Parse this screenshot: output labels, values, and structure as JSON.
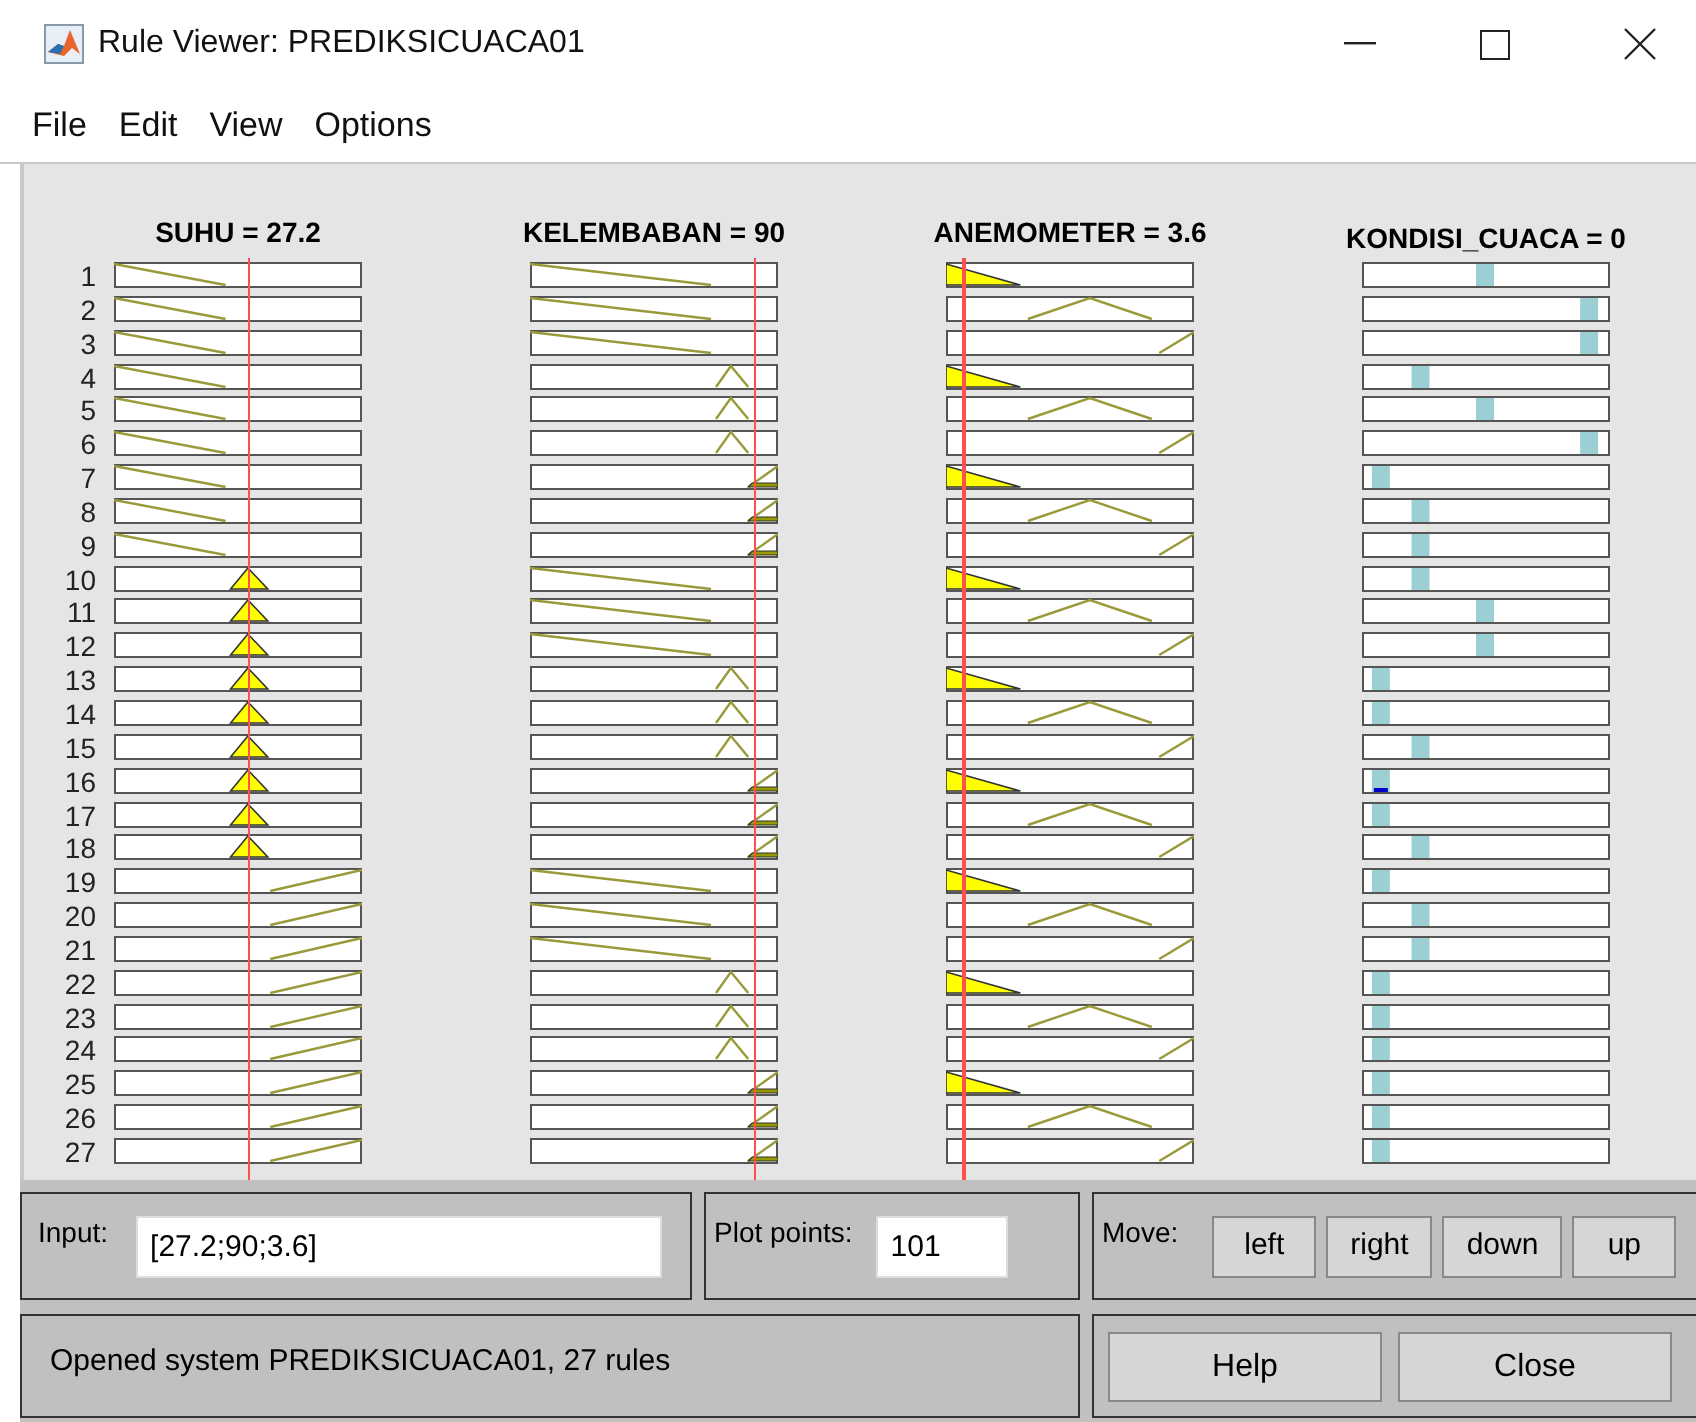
{
  "window": {
    "title": "Rule Viewer: PREDIKSICUACA01"
  },
  "menu": [
    "File",
    "Edit",
    "View",
    "Options"
  ],
  "variables": [
    {
      "label": "SUHU = 27.2"
    },
    {
      "label": "KELEMBABAN = 90"
    },
    {
      "label": "ANEMOMETER = 3.6"
    },
    {
      "label": "KONDISI_CUACA = 0"
    }
  ],
  "rules": [
    {
      "number": "1",
      "inputs": [
        {
          "kind": "falling",
          "fired": false
        },
        {
          "kind": "falling",
          "fired": false
        },
        {
          "kind": "falling",
          "fired": true
        }
      ],
      "output": {
        "kind": "p3",
        "fired": false
      }
    },
    {
      "number": "2",
      "inputs": [
        {
          "kind": "falling",
          "fired": false
        },
        {
          "kind": "falling",
          "fired": false
        },
        {
          "kind": "triangle",
          "fired": false
        }
      ],
      "output": {
        "kind": "p5",
        "fired": false
      }
    },
    {
      "number": "3",
      "inputs": [
        {
          "kind": "falling",
          "fired": false
        },
        {
          "kind": "falling",
          "fired": false
        },
        {
          "kind": "rising",
          "fired": false
        }
      ],
      "output": {
        "kind": "p5",
        "fired": false
      }
    },
    {
      "number": "4",
      "inputs": [
        {
          "kind": "falling",
          "fired": false
        },
        {
          "kind": "triangle",
          "fired": false
        },
        {
          "kind": "falling",
          "fired": true
        }
      ],
      "output": {
        "kind": "p2",
        "fired": false
      }
    },
    {
      "number": "5",
      "inputs": [
        {
          "kind": "falling",
          "fired": false
        },
        {
          "kind": "triangle",
          "fired": false
        },
        {
          "kind": "triangle",
          "fired": false
        }
      ],
      "output": {
        "kind": "p3",
        "fired": false
      }
    },
    {
      "number": "6",
      "inputs": [
        {
          "kind": "falling",
          "fired": false
        },
        {
          "kind": "triangle",
          "fired": false
        },
        {
          "kind": "rising",
          "fired": false
        }
      ],
      "output": {
        "kind": "p5",
        "fired": false
      }
    },
    {
      "number": "7",
      "inputs": [
        {
          "kind": "falling",
          "fired": false
        },
        {
          "kind": "rising",
          "fired": true
        },
        {
          "kind": "falling",
          "fired": true
        }
      ],
      "output": {
        "kind": "p1",
        "fired": false
      }
    },
    {
      "number": "8",
      "inputs": [
        {
          "kind": "falling",
          "fired": false
        },
        {
          "kind": "rising",
          "fired": true
        },
        {
          "kind": "triangle",
          "fired": false
        }
      ],
      "output": {
        "kind": "p2",
        "fired": false
      }
    },
    {
      "number": "9",
      "inputs": [
        {
          "kind": "falling",
          "fired": false
        },
        {
          "kind": "rising",
          "fired": true
        },
        {
          "kind": "rising",
          "fired": false
        }
      ],
      "output": {
        "kind": "p2",
        "fired": false
      }
    },
    {
      "number": "10",
      "inputs": [
        {
          "kind": "triangle",
          "fired": true
        },
        {
          "kind": "falling",
          "fired": false
        },
        {
          "kind": "falling",
          "fired": true
        }
      ],
      "output": {
        "kind": "p2",
        "fired": false
      }
    },
    {
      "number": "11",
      "inputs": [
        {
          "kind": "triangle",
          "fired": true
        },
        {
          "kind": "falling",
          "fired": false
        },
        {
          "kind": "triangle",
          "fired": false
        }
      ],
      "output": {
        "kind": "p3",
        "fired": false
      }
    },
    {
      "number": "12",
      "inputs": [
        {
          "kind": "triangle",
          "fired": true
        },
        {
          "kind": "falling",
          "fired": false
        },
        {
          "kind": "rising",
          "fired": false
        }
      ],
      "output": {
        "kind": "p3",
        "fired": false
      }
    },
    {
      "number": "13",
      "inputs": [
        {
          "kind": "triangle",
          "fired": true
        },
        {
          "kind": "triangle",
          "fired": false
        },
        {
          "kind": "falling",
          "fired": true
        }
      ],
      "output": {
        "kind": "p1",
        "fired": false
      }
    },
    {
      "number": "14",
      "inputs": [
        {
          "kind": "triangle",
          "fired": true
        },
        {
          "kind": "triangle",
          "fired": false
        },
        {
          "kind": "triangle",
          "fired": false
        }
      ],
      "output": {
        "kind": "p1",
        "fired": false
      }
    },
    {
      "number": "15",
      "inputs": [
        {
          "kind": "triangle",
          "fired": true
        },
        {
          "kind": "triangle",
          "fired": false
        },
        {
          "kind": "rising",
          "fired": false
        }
      ],
      "output": {
        "kind": "p2",
        "fired": false
      }
    },
    {
      "number": "16",
      "inputs": [
        {
          "kind": "triangle",
          "fired": true
        },
        {
          "kind": "rising",
          "fired": true
        },
        {
          "kind": "falling",
          "fired": true
        }
      ],
      "output": {
        "kind": "p1",
        "fired": true
      }
    },
    {
      "number": "17",
      "inputs": [
        {
          "kind": "triangle",
          "fired": true
        },
        {
          "kind": "rising",
          "fired": true
        },
        {
          "kind": "triangle",
          "fired": false
        }
      ],
      "output": {
        "kind": "p1",
        "fired": false
      }
    },
    {
      "number": "18",
      "inputs": [
        {
          "kind": "triangle",
          "fired": true
        },
        {
          "kind": "rising",
          "fired": true
        },
        {
          "kind": "rising",
          "fired": false
        }
      ],
      "output": {
        "kind": "p2",
        "fired": false
      }
    },
    {
      "number": "19",
      "inputs": [
        {
          "kind": "rising",
          "fired": false
        },
        {
          "kind": "falling",
          "fired": false
        },
        {
          "kind": "falling",
          "fired": true
        }
      ],
      "output": {
        "kind": "p1",
        "fired": false
      }
    },
    {
      "number": "20",
      "inputs": [
        {
          "kind": "rising",
          "fired": false
        },
        {
          "kind": "falling",
          "fired": false
        },
        {
          "kind": "triangle",
          "fired": false
        }
      ],
      "output": {
        "kind": "p2",
        "fired": false
      }
    },
    {
      "number": "21",
      "inputs": [
        {
          "kind": "rising",
          "fired": false
        },
        {
          "kind": "falling",
          "fired": false
        },
        {
          "kind": "rising",
          "fired": false
        }
      ],
      "output": {
        "kind": "p2",
        "fired": false
      }
    },
    {
      "number": "22",
      "inputs": [
        {
          "kind": "rising",
          "fired": false
        },
        {
          "kind": "triangle",
          "fired": false
        },
        {
          "kind": "falling",
          "fired": true
        }
      ],
      "output": {
        "kind": "p1",
        "fired": false
      }
    },
    {
      "number": "23",
      "inputs": [
        {
          "kind": "rising",
          "fired": false
        },
        {
          "kind": "triangle",
          "fired": false
        },
        {
          "kind": "triangle",
          "fired": false
        }
      ],
      "output": {
        "kind": "p1",
        "fired": false
      }
    },
    {
      "number": "24",
      "inputs": [
        {
          "kind": "rising",
          "fired": false
        },
        {
          "kind": "triangle",
          "fired": false
        },
        {
          "kind": "rising",
          "fired": false
        }
      ],
      "output": {
        "kind": "p1",
        "fired": false
      }
    },
    {
      "number": "25",
      "inputs": [
        {
          "kind": "rising",
          "fired": false
        },
        {
          "kind": "rising",
          "fired": true
        },
        {
          "kind": "falling",
          "fired": true
        }
      ],
      "output": {
        "kind": "p1",
        "fired": false
      }
    },
    {
      "number": "26",
      "inputs": [
        {
          "kind": "rising",
          "fired": false
        },
        {
          "kind": "rising",
          "fired": true
        },
        {
          "kind": "triangle",
          "fired": false
        }
      ],
      "output": {
        "kind": "p1",
        "fired": false
      }
    },
    {
      "number": "27",
      "inputs": [
        {
          "kind": "rising",
          "fired": false
        },
        {
          "kind": "rising",
          "fired": true
        },
        {
          "kind": "rising",
          "fired": false
        }
      ],
      "output": {
        "kind": "p1",
        "fired": false
      }
    }
  ],
  "input": {
    "label": "Input:",
    "value": "[27.2;90;3.6]"
  },
  "plot_points": {
    "label": "Plot points:",
    "value": "101"
  },
  "move": {
    "label": "Move:",
    "buttons": [
      "left",
      "right",
      "down",
      "up"
    ]
  },
  "status": "Opened system PREDIKSICUACA01, 27 rules",
  "buttons": [
    "Help",
    "Close"
  ]
}
